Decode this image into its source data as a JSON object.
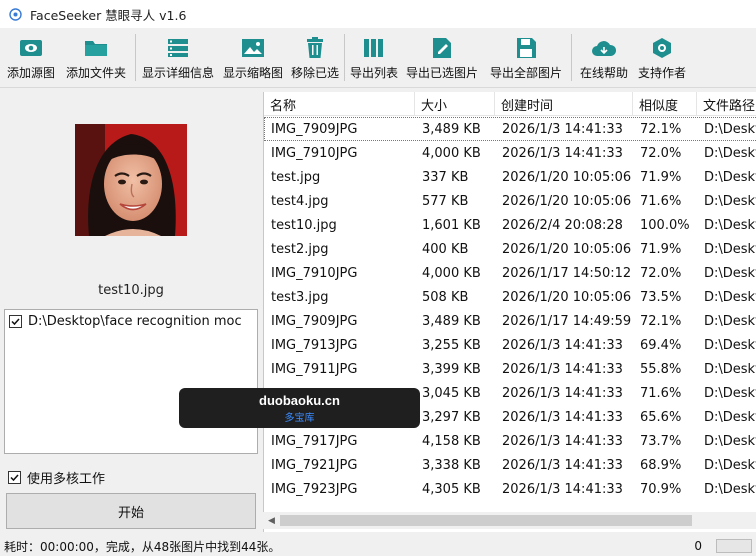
{
  "window": {
    "title": "FaceSeeker 慧眼寻人 v1.6"
  },
  "toolbar": {
    "buttons": [
      {
        "label": "添加源图",
        "icon": "image-icon"
      },
      {
        "label": "添加文件夹",
        "icon": "folder-icon"
      },
      {
        "label": "显示详细信息",
        "icon": "details-list-icon"
      },
      {
        "label": "显示缩略图",
        "icon": "thumbnails-icon"
      },
      {
        "label": "移除已选",
        "icon": "trash-icon"
      },
      {
        "label": "导出列表",
        "icon": "export-list-icon"
      },
      {
        "label": "导出已选图片",
        "icon": "export-selected-icon"
      },
      {
        "label": "导出全部图片",
        "icon": "save-icon"
      },
      {
        "label": "在线帮助",
        "icon": "cloud-icon"
      },
      {
        "label": "支持作者",
        "icon": "support-badge-icon"
      }
    ]
  },
  "left": {
    "source_caption": "test10.jpg",
    "paths": [
      {
        "text": "D:\\Desktop\\face recognition moc",
        "checked": true
      }
    ],
    "multicore": {
      "label": "使用多核工作",
      "checked": true
    },
    "start_label": "开始"
  },
  "table": {
    "columns": [
      "名称",
      "大小",
      "创建时间",
      "相似度",
      "文件路径"
    ],
    "rows": [
      [
        "IMG_7909JPG",
        "3,489 KB",
        "2026/1/3 14:41:33",
        "72.1%",
        "D:\\Deskt"
      ],
      [
        "IMG_7910JPG",
        "4,000 KB",
        "2026/1/3 14:41:33",
        "72.0%",
        "D:\\Deskt"
      ],
      [
        "test.jpg",
        "337 KB",
        "2026/1/20 10:05:06",
        "71.9%",
        "D:\\Deskt"
      ],
      [
        "test4.jpg",
        "577 KB",
        "2026/1/20 10:05:06",
        "71.6%",
        "D:\\Deskt"
      ],
      [
        "test10.jpg",
        "1,601 KB",
        "2026/2/4 20:08:28",
        "100.0%",
        "D:\\Deskt"
      ],
      [
        "test2.jpg",
        "400 KB",
        "2026/1/20 10:05:06",
        "71.9%",
        "D:\\Deskt"
      ],
      [
        "IMG_7910JPG",
        "4,000 KB",
        "2026/1/17 14:50:12",
        "72.0%",
        "D:\\Deskt"
      ],
      [
        "test3.jpg",
        "508 KB",
        "2026/1/20 10:05:06",
        "73.5%",
        "D:\\Deskt"
      ],
      [
        "IMG_7909JPG",
        "3,489 KB",
        "2026/1/17 14:49:59",
        "72.1%",
        "D:\\Deskt"
      ],
      [
        "IMG_7913JPG",
        "3,255 KB",
        "2026/1/3 14:41:33",
        "69.4%",
        "D:\\Deskt"
      ],
      [
        "IMG_7911JPG",
        "3,399 KB",
        "2026/1/3 14:41:33",
        "55.8%",
        "D:\\Deskt"
      ],
      [
        "",
        "3,045 KB",
        "2026/1/3 14:41:33",
        "71.6%",
        "D:\\Deskt"
      ],
      [
        "",
        "3,297 KB",
        "2026/1/3 14:41:33",
        "65.6%",
        "D:\\Deskt"
      ],
      [
        "IMG_7917JPG",
        "4,158 KB",
        "2026/1/3 14:41:33",
        "73.7%",
        "D:\\Deskt"
      ],
      [
        "IMG_7921JPG",
        "3,338 KB",
        "2026/1/3 14:41:33",
        "68.9%",
        "D:\\Deskt"
      ],
      [
        "IMG_7923JPG",
        "4,305 KB",
        "2026/1/3 14:41:33",
        "70.9%",
        "D:\\Deskt"
      ]
    ]
  },
  "status": {
    "message": "耗时：00:00:00，完成，从48张图片中找到44张。",
    "count": "0",
    "progress": 0.0
  },
  "watermark": {
    "line1": "duobaoku.cn",
    "line2": "多宝库"
  },
  "colors": {
    "accent": "#1e8e8e",
    "selection_outline": "#777777"
  }
}
